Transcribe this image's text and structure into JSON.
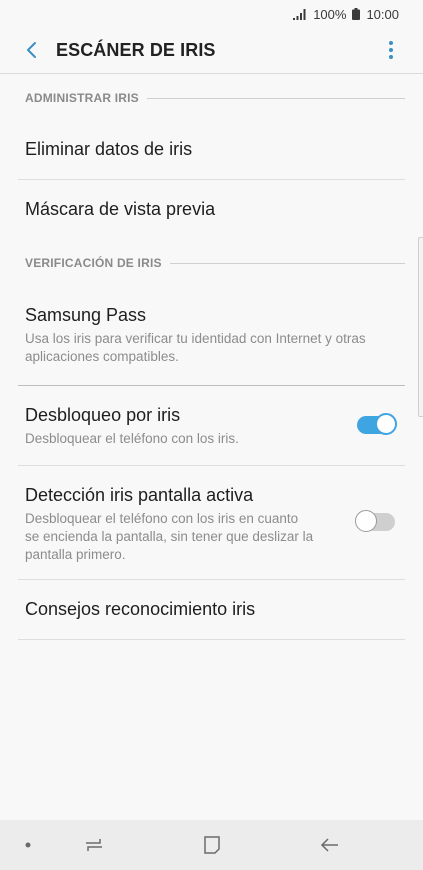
{
  "status": {
    "battery_percent": "100%",
    "time": "10:00",
    "icons": [
      "signal-icon",
      "battery-icon"
    ]
  },
  "header": {
    "title": "ESCÁNER DE IRIS",
    "icons": [
      "back-arrow-icon",
      "more-vertical-icon"
    ]
  },
  "sections": [
    {
      "header": "ADMINISTRAR IRIS"
    },
    {
      "header": "VERIFICACIÓN DE IRIS"
    }
  ],
  "items": {
    "eliminar": {
      "title": "Eliminar datos de iris"
    },
    "mascara": {
      "title": "Máscara de vista previa"
    },
    "samsung_pass": {
      "title": "Samsung Pass",
      "line1": "Usa los iris para verificar tu identidad con Internet y otras",
      "line2": "aplicaciones compatibles."
    },
    "desbloqueo": {
      "title": "Desbloqueo por iris",
      "subtitle": "Desbloquear el teléfono con los iris.",
      "toggle_on": true
    },
    "deteccion": {
      "title": "Detección iris pantalla activa",
      "line1": "Desbloquear el teléfono con los iris en cuanto",
      "line2": "se encienda la pantalla, sin tener que deslizar la",
      "line3": "pantalla primero.",
      "toggle_on": false
    },
    "consejos": {
      "title": "Consejos reconocimiento iris"
    }
  },
  "colors": {
    "accent": "#3fa5e0",
    "background": "#f8f8f8",
    "toggle_off": "#cfcfcf"
  },
  "navigation": {
    "icons": [
      "dot-icon",
      "recents-icon",
      "home-icon",
      "back-icon"
    ]
  }
}
